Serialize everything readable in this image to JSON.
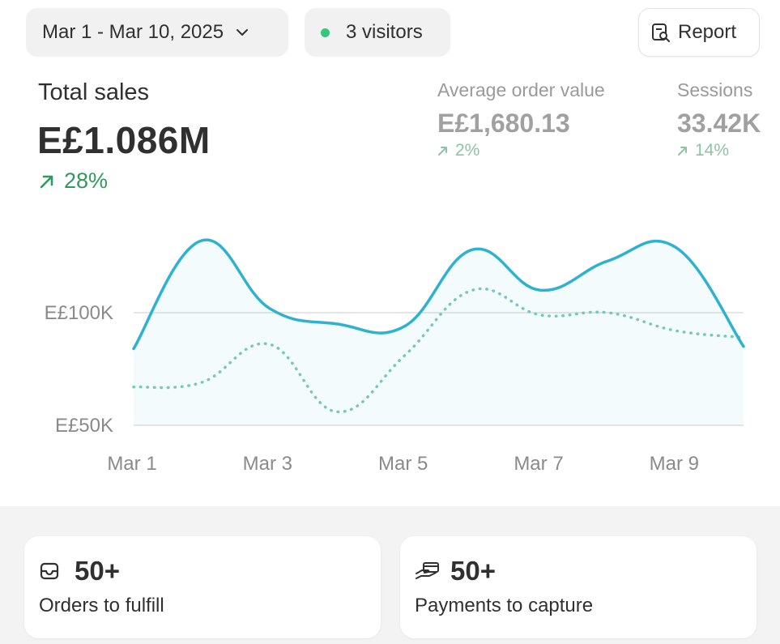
{
  "toolbar": {
    "date_range": "Mar 1 - Mar 10, 2025",
    "visitors": "3 visitors",
    "report_label": "Report"
  },
  "metrics": {
    "total_sales": {
      "label": "Total sales",
      "value": "E£1.086M",
      "change": "28%"
    },
    "average_order_value": {
      "label": "Average order value",
      "value": "E£1,680.13",
      "change": "2%"
    },
    "sessions": {
      "label": "Sessions",
      "value": "33.42K",
      "change": "14%"
    }
  },
  "chart_data": {
    "type": "line",
    "x": [
      "Mar 1",
      "Mar 2",
      "Mar 3",
      "Mar 4",
      "Mar 5",
      "Mar 6",
      "Mar 7",
      "Mar 8",
      "Mar 9",
      "Mar 10"
    ],
    "xtick_labels": [
      "Mar 1",
      "Mar 3",
      "Mar 5",
      "Mar 7",
      "Mar 9"
    ],
    "ytick_labels": [
      "E£100K",
      "E£50K"
    ],
    "ytick_values": [
      100000,
      50000
    ],
    "series": [
      {
        "style": "solid",
        "color": "#2fb1d2",
        "values": [
          84000,
          132000,
          102000,
          95000,
          94000,
          128000,
          110000,
          123000,
          129000,
          85000
        ]
      },
      {
        "style": "dotted",
        "color": "#7cc9b9",
        "values": [
          67000,
          69000,
          86000,
          56000,
          81000,
          110000,
          99000,
          100000,
          92000,
          89000
        ]
      }
    ],
    "ylim": [
      40000,
      150000
    ],
    "grid": true
  },
  "cards": {
    "orders": {
      "count": "50+",
      "label": "Orders to fulfill"
    },
    "payments": {
      "count": "50+",
      "label": "Payments to capture"
    }
  },
  "colors": {
    "positive": "#2e9a5e",
    "line_primary": "#2fb1d2",
    "line_comparison": "#7cc9b9",
    "visitor_dot": "#34c77b"
  }
}
